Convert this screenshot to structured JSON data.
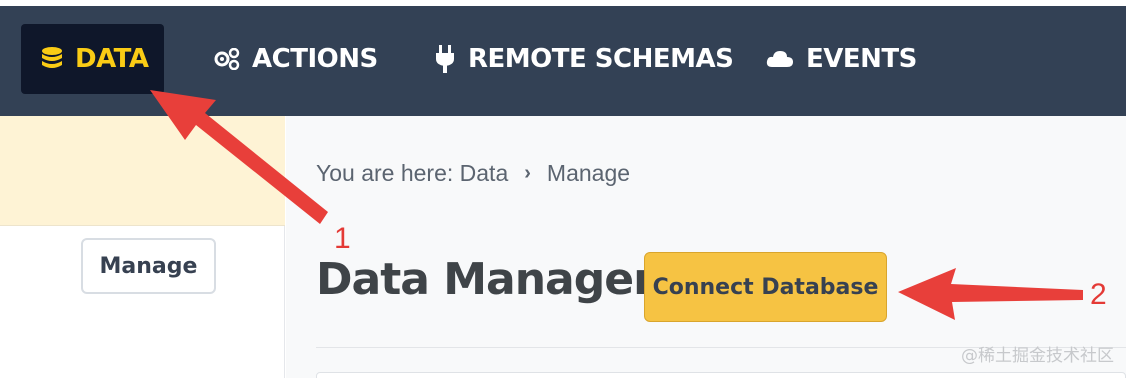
{
  "nav": {
    "items": [
      {
        "label": "DATA",
        "icon": "database-icon"
      },
      {
        "label": "ACTIONS",
        "icon": "gears-icon"
      },
      {
        "label": "REMOTE SCHEMAS",
        "icon": "plug-icon"
      },
      {
        "label": "EVENTS",
        "icon": "cloud-icon"
      }
    ],
    "active_color": "#facc15",
    "bar_color": "#334155"
  },
  "sidebar": {
    "manage_label": "Manage",
    "notice_color": "#fef3d5"
  },
  "main": {
    "breadcrumb": {
      "prefix": "You are here: Data",
      "separator": "›",
      "current": "Manage"
    },
    "title": "Data Manager",
    "connect_button_label": "Connect Database",
    "connect_button_color": "#f6c343"
  },
  "annotations": {
    "marker_1": "1",
    "marker_2": "2",
    "color": "#e43a36"
  },
  "watermark": "@稀土掘金技术社区"
}
